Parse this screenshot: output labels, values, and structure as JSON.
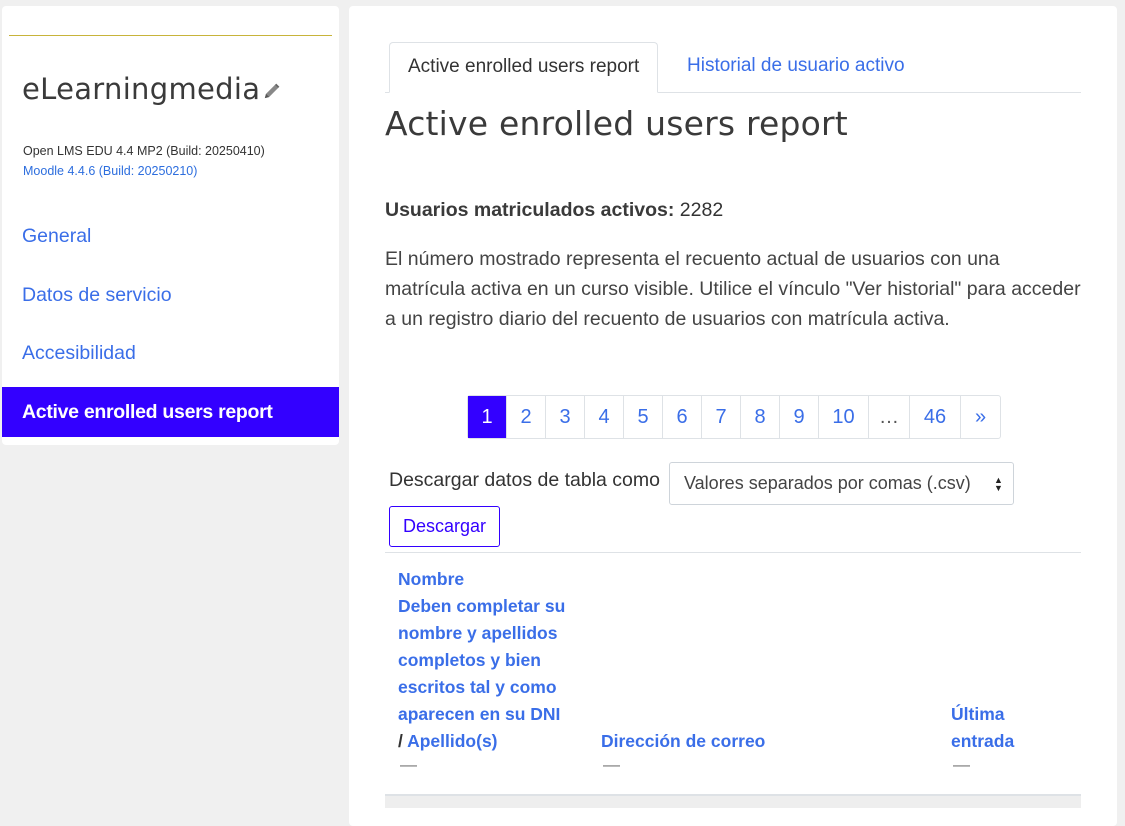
{
  "sidebar": {
    "site_name": "eLearningmedia",
    "version_lms": "Open LMS EDU 4.4 MP2 (Build: 20250410)",
    "version_moodle": "Moodle 4.4.6 (Build: 20250210)",
    "items": [
      {
        "label": "General"
      },
      {
        "label": "Datos de servicio"
      },
      {
        "label": "Accesibilidad"
      },
      {
        "label": "Active enrolled users report",
        "active": true
      }
    ]
  },
  "tabs": [
    {
      "label": "Active enrolled users report",
      "active": true
    },
    {
      "label": "Historial de usuario activo"
    }
  ],
  "main": {
    "title": "Active enrolled users report",
    "count_label": "Usuarios matriculados activos:",
    "count_value": "2282",
    "description": "El número mostrado representa el recuento actual de usuarios con una matrícula activa en un curso visible. Utilice el vínculo \"Ver historial\" para acceder a un registro diario del recuento de usuarios con matrícula activa."
  },
  "pagination": {
    "pages": [
      "1",
      "2",
      "3",
      "4",
      "5",
      "6",
      "7",
      "8",
      "9",
      "10",
      "…",
      "46",
      "»"
    ],
    "current": "1"
  },
  "download": {
    "label": "Descargar datos de tabla como",
    "selected_format": "Valores separados por comas (.csv)",
    "button": "Descargar"
  },
  "table": {
    "col_name_l1": "Nombre",
    "col_name_l2": "Deben completar su",
    "col_name_l3": "nombre y apellidos",
    "col_name_l4": "completos y bien",
    "col_name_l5": "escritos tal y como",
    "col_name_l6": "aparecen en su DNI",
    "col_name_sep": "/",
    "col_surname": "Apellido(s)",
    "col_email": "Dirección de correo",
    "col_last_l1": "Última",
    "col_last_l2": "entrada",
    "dash": "—"
  },
  "colors": {
    "accent": "#3300ff",
    "link": "#3a6ee8"
  }
}
